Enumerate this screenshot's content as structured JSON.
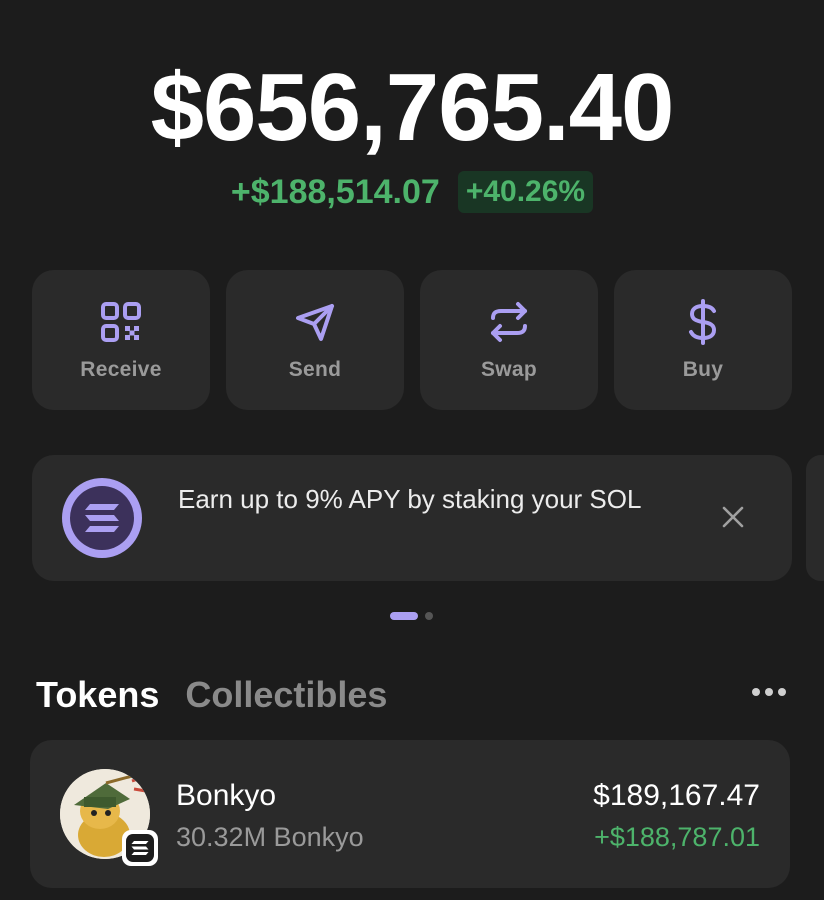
{
  "portfolio": {
    "balance": "$656,765.40",
    "change_amount": "+$188,514.07",
    "change_percent": "+40.26%"
  },
  "actions": [
    {
      "label": "Receive",
      "icon": "qr-code-icon"
    },
    {
      "label": "Send",
      "icon": "send-icon"
    },
    {
      "label": "Swap",
      "icon": "swap-icon"
    },
    {
      "label": "Buy",
      "icon": "dollar-icon"
    }
  ],
  "promo": {
    "text": "Earn up to 9% APY by staking your SOL",
    "icon": "solana-icon",
    "close_icon": "close-icon"
  },
  "carousel": {
    "pages": 2,
    "active": 0
  },
  "tabs": [
    {
      "label": "Tokens",
      "active": true
    },
    {
      "label": "Collectibles",
      "active": false
    }
  ],
  "tokens": [
    {
      "name": "Bonkyo",
      "amount": "30.32M Bonkyo",
      "value": "$189,167.47",
      "change": "+$188,787.01",
      "chain_icon": "solana-icon"
    }
  ],
  "colors": {
    "background": "#1c1c1c",
    "card": "#2a2a2a",
    "accent": "#ab9ff2",
    "positive": "#4db36b"
  }
}
